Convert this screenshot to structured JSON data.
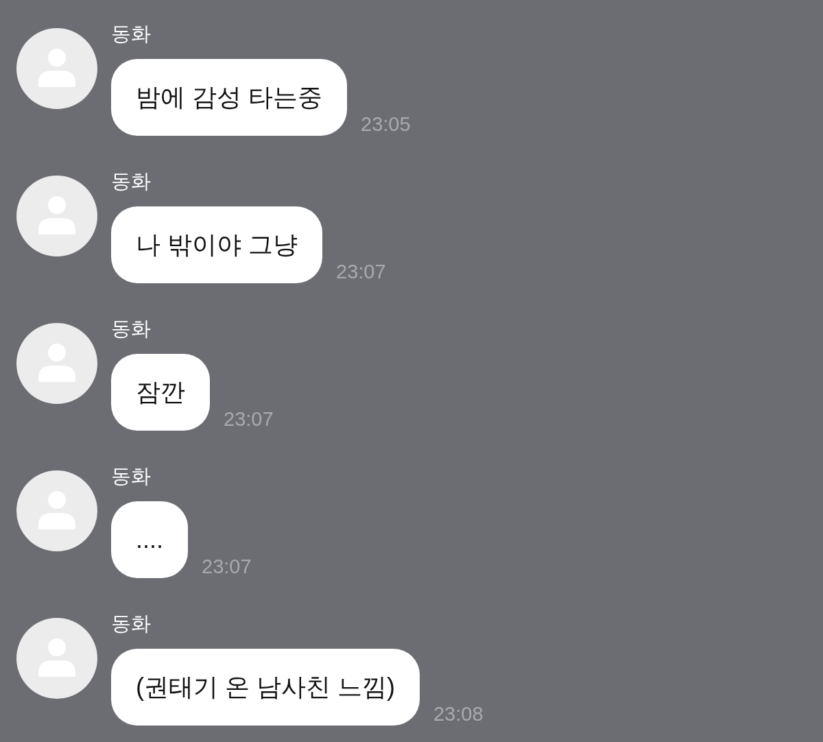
{
  "messages": [
    {
      "sender": "동화",
      "text": "밤에 감성 타는중",
      "time": "23:05"
    },
    {
      "sender": "동화",
      "text": "나 밖이야 그냥",
      "time": "23:07"
    },
    {
      "sender": "동화",
      "text": "잠깐",
      "time": "23:07"
    },
    {
      "sender": "동화",
      "text": "....",
      "time": "23:07"
    },
    {
      "sender": "동화",
      "text": "(권태기 온 남사친 느낌)",
      "time": "23:08"
    }
  ]
}
